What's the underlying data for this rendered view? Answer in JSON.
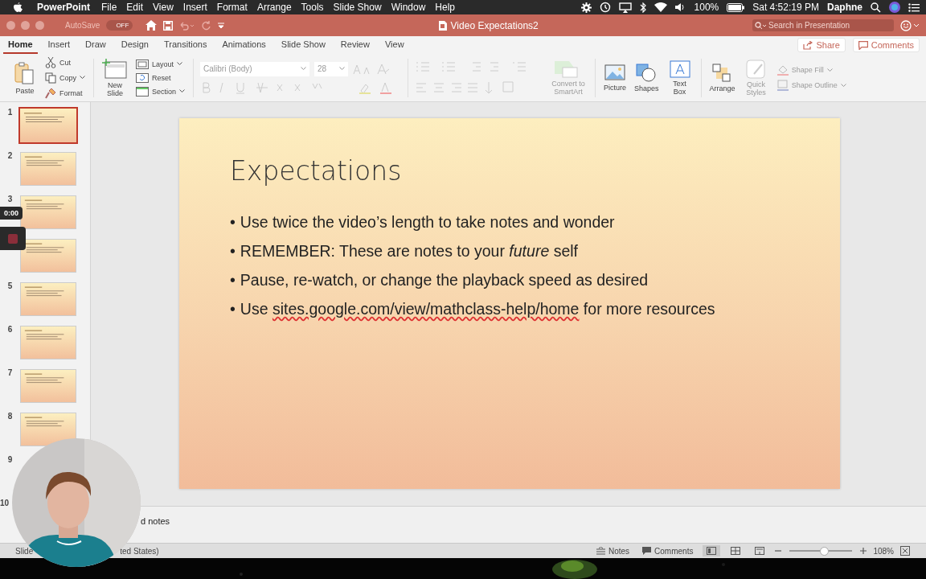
{
  "menubar": {
    "app_name": "PowerPoint",
    "menus": [
      "File",
      "Edit",
      "View",
      "Insert",
      "Format",
      "Arrange",
      "Tools",
      "Slide Show",
      "Window",
      "Help"
    ],
    "battery": "100%",
    "clock": "Sat 4:52:19 PM",
    "user": "Daphne"
  },
  "titlebar": {
    "autosave": "AutoSave",
    "autosave_toggle": {
      "label": "OFF",
      "on": false
    },
    "title": "Video Expectations2",
    "search": {
      "placeholder": "Search in Presentation"
    }
  },
  "tabs": [
    {
      "label": "Home",
      "selected": true
    },
    {
      "label": "Insert",
      "selected": false
    },
    {
      "label": "Draw",
      "selected": false
    },
    {
      "label": "Design",
      "selected": false
    },
    {
      "label": "Transitions",
      "selected": false
    },
    {
      "label": "Animations",
      "selected": false
    },
    {
      "label": "Slide Show",
      "selected": false
    },
    {
      "label": "Review",
      "selected": false
    },
    {
      "label": "View",
      "selected": false
    }
  ],
  "share_button": "Share",
  "comments_button": "Comments",
  "ribbon": {
    "paste": "Paste",
    "cut": "Cut",
    "copy": "Copy",
    "format": "Format",
    "new_slide": "New Slide",
    "layout": "Layout",
    "reset": "Reset",
    "section": "Section",
    "font": {
      "value": "Calibri (Body)",
      "disabled": true
    },
    "size": {
      "value": "28",
      "disabled": true
    },
    "smartart": {
      "label": "Convert to SmartArt",
      "disabled": true
    },
    "picture": "Picture",
    "shapes": "Shapes",
    "text_box": "Text Box",
    "arrange": "Arrange",
    "quick_styles": {
      "label": "Quick Styles",
      "disabled": true
    },
    "shape_fill": {
      "label": "Shape Fill",
      "disabled": true
    },
    "shape_outline": {
      "label": "Shape Outline",
      "disabled": true
    }
  },
  "thumbnails": [
    {
      "number": "1",
      "selected": true
    },
    {
      "number": "2",
      "selected": false
    },
    {
      "number": "3",
      "selected": false
    },
    {
      "selected": false
    },
    {
      "number": "5",
      "selected": false
    },
    {
      "number": "6",
      "selected": false
    },
    {
      "number": "7",
      "selected": false
    },
    {
      "number": "8",
      "selected": false
    }
  ],
  "more_slide_numbers": [
    "9",
    "10"
  ],
  "slide": {
    "title": "Expectations",
    "bullet_mark": "•",
    "bullets": [
      "Use twice the video’s length to take notes and wonder",
      "REMEMBER: These are notes to your *future* self",
      "Pause, re-watch, or change the playback speed as desired"
    ],
    "link_bullet": {
      "before": "Use ",
      "link": "sites.google.com/view/mathclass-help/home",
      "after": " for more resources"
    }
  },
  "notes": "d notes",
  "recording": {
    "timer": "0:00"
  },
  "status_bar": {
    "slide": "Slide",
    "language": "ted States)",
    "notes": "Notes",
    "comments": "Comments",
    "views": [
      {
        "selected": true
      },
      {
        "selected": false
      },
      {
        "selected": false
      }
    ],
    "zoom": {
      "level": 0.55
    },
    "zoom_percent": "108%"
  }
}
